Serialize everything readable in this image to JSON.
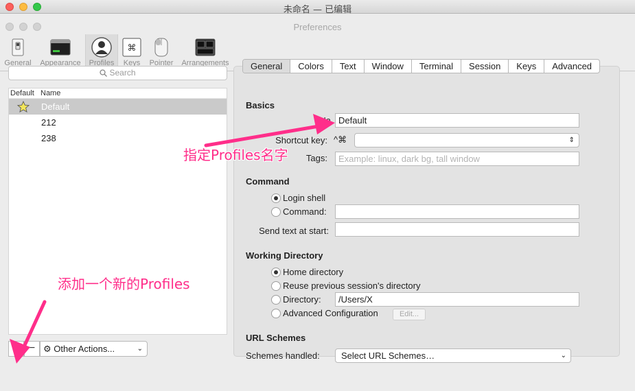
{
  "window": {
    "title": "未命名 — 已编辑"
  },
  "prefs": {
    "title": "Preferences",
    "toolbar": [
      {
        "label": "General",
        "icon": "switch-icon"
      },
      {
        "label": "Appearance",
        "icon": "appearance-icon"
      },
      {
        "label": "Profiles",
        "icon": "profile-icon",
        "active": true
      },
      {
        "label": "Keys",
        "icon": "command-key-icon"
      },
      {
        "label": "Pointer",
        "icon": "mouse-icon"
      },
      {
        "label": "Arrangements",
        "icon": "windows-icon"
      }
    ]
  },
  "left": {
    "search_placeholder": "Search",
    "col_default": "Default",
    "col_name": "Name",
    "profiles": [
      {
        "name": "Default",
        "is_default": true,
        "selected": true
      },
      {
        "name": "212"
      },
      {
        "name": "238"
      }
    ],
    "add_label": "+",
    "remove_label": "−",
    "other_actions": "Other Actions...",
    "icons": {
      "gear": "⚙",
      "chevron": "⌄"
    }
  },
  "tabs": [
    "General",
    "Colors",
    "Text",
    "Window",
    "Terminal",
    "Session",
    "Keys",
    "Advanced"
  ],
  "basics": {
    "heading": "Basics",
    "name_label": "Na",
    "name_value": "Default",
    "shortcut_label": "Shortcut key:",
    "shortcut_prefix": "^⌘",
    "tags_label": "Tags:",
    "tags_placeholder": "Example: linux, dark bg, tall window"
  },
  "command": {
    "heading": "Command",
    "login_shell": "Login shell",
    "command_label": "Command:",
    "send_text_label": "Send text at start:"
  },
  "workdir": {
    "heading": "Working Directory",
    "home": "Home directory",
    "reuse": "Reuse previous session's directory",
    "directory_label": "Directory:",
    "directory_value": "/Users/X",
    "advanced": "Advanced Configuration",
    "edit_btn": "Edit..."
  },
  "url": {
    "heading": "URL Schemes",
    "label": "Schemes handled:",
    "select_value": "Select URL Schemes…"
  },
  "annotations": {
    "name_note": "指定Profiles名字",
    "add_note": "添加一个新的Profiles"
  },
  "colors": {
    "annotation": "#ff2e8a",
    "selected_row": "#cacaca"
  }
}
